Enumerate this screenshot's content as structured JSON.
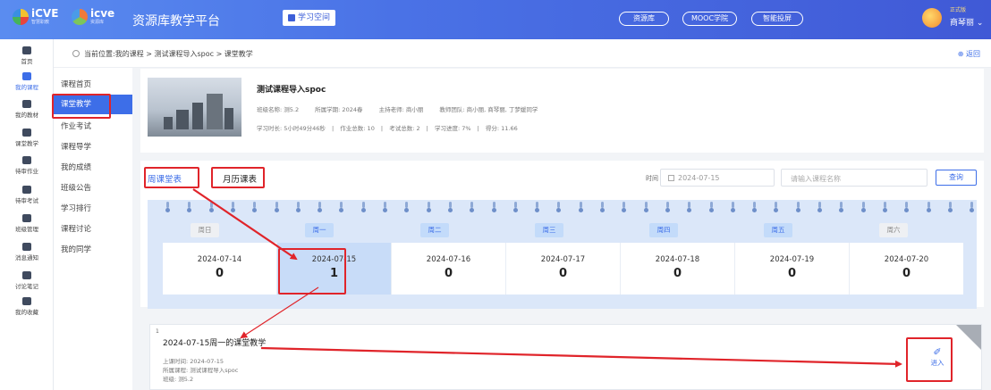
{
  "header": {
    "logo1": "iCVE",
    "logo1_sub": "智慧职教",
    "logo2": "icve",
    "logo2_sub": "资源库",
    "platform": "资源库教学平台",
    "study_space": "学习空间",
    "pills": [
      "资源库",
      "MOOC学院",
      "智能投屏"
    ],
    "vip": "正式版",
    "user": "商琴丽"
  },
  "leftnav": [
    "首页",
    "我的课程",
    "我的教材",
    "课堂教学",
    "待审作业",
    "待审考试",
    "班级管理",
    "消息通知",
    "讨论笔记",
    "我的收藏"
  ],
  "breadcrumb": {
    "text": "当前位置:我的课程 > 测试课程导入spoc > 课堂教学",
    "back": "返回"
  },
  "submenu": [
    "课程首页",
    "课堂教学",
    "作业考试",
    "课程导学",
    "我的成绩",
    "班级公告",
    "学习排行",
    "课程讨论",
    "我的同学"
  ],
  "course": {
    "title": "测试课程导入spoc",
    "class_name": "班级名称: 测5.2",
    "term": "所属学期: 2024春",
    "teacher": "主持老师: 商小丽",
    "team": "教师团队: 商小丽, 商琴丽, 丁梦媛同学",
    "stats": [
      "学习时长: 5小时49分46秒",
      "|",
      "作业总数: 10",
      "|",
      "考试总数: 2",
      "|",
      "学习进度: 7%",
      "|",
      "得分: 11.66"
    ]
  },
  "schedule": {
    "tab_week": "周课堂表",
    "tab_month": "月历课表",
    "time_label": "时间",
    "date_value": "2024-07-15",
    "search_placeholder": "请输入课程名称",
    "query": "查询",
    "days": [
      {
        "weekday": "周日",
        "date": "2024-07-14",
        "count": "0",
        "has": false
      },
      {
        "weekday": "周一",
        "date": "2024-07-15",
        "count": "1",
        "has": true
      },
      {
        "weekday": "周二",
        "date": "2024-07-16",
        "count": "0",
        "has": true
      },
      {
        "weekday": "周三",
        "date": "2024-07-17",
        "count": "0",
        "has": true
      },
      {
        "weekday": "周四",
        "date": "2024-07-18",
        "count": "0",
        "has": true
      },
      {
        "weekday": "周五",
        "date": "2024-07-19",
        "count": "0",
        "has": true
      },
      {
        "weekday": "周六",
        "date": "2024-07-20",
        "count": "0",
        "has": false
      }
    ]
  },
  "lesson": {
    "index": "1",
    "title": "2024-07-15周一的课堂教学",
    "time": "上课时间: 2024-07-15",
    "course": "所属课程: 测试课程导入spoc",
    "class": "班级: 测5.2",
    "enter": "进入"
  },
  "colors": {
    "primary": "#3d6ee8",
    "annotation": "#e0242a"
  }
}
